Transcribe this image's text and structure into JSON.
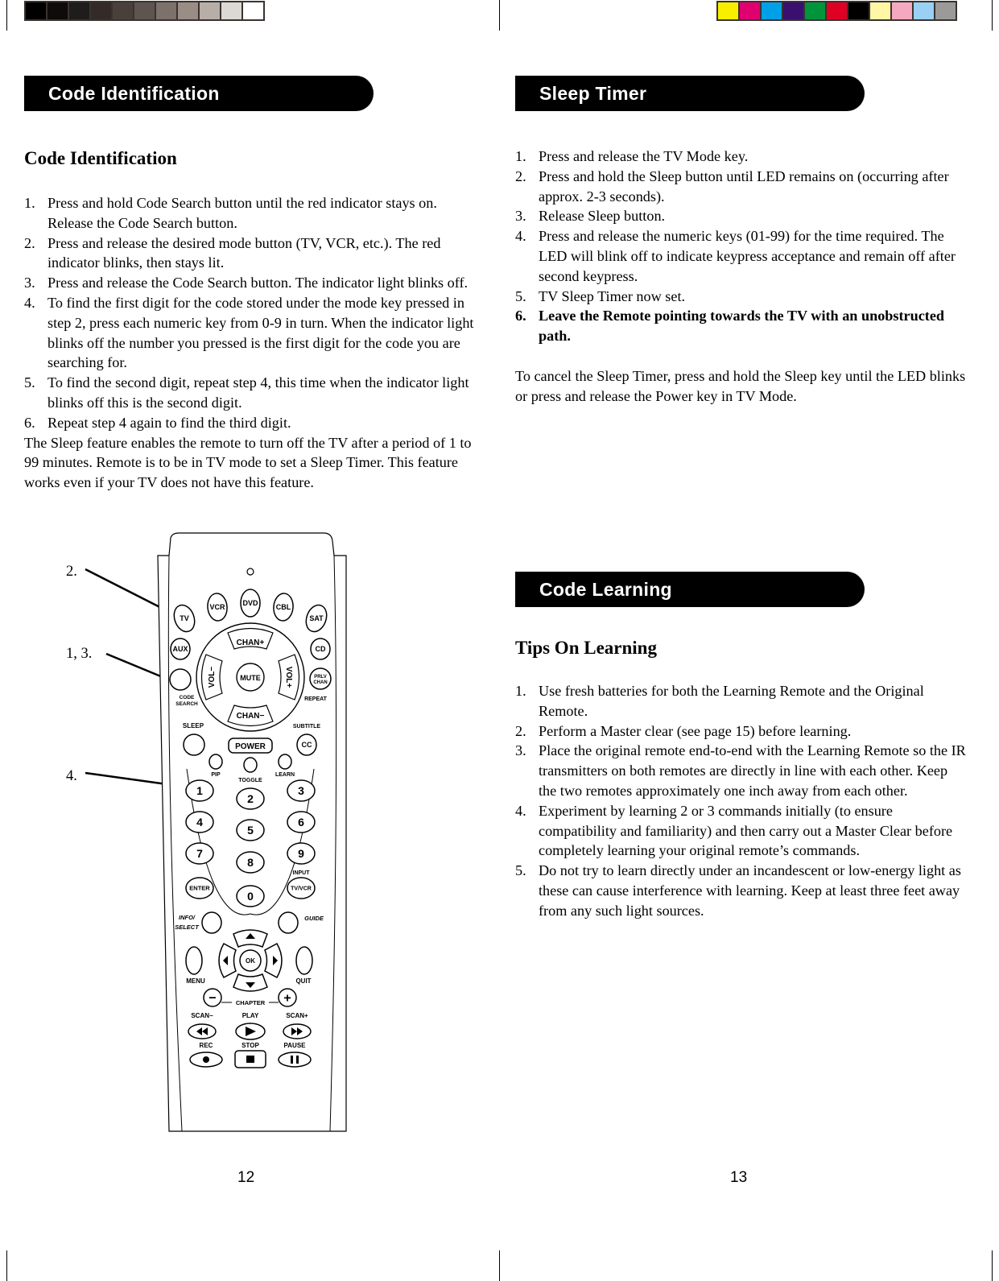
{
  "color_bars": {
    "grayscale": [
      "#000000",
      "#0f0b0b",
      "#1f1d1b",
      "#342a27",
      "#4a403b",
      "#5e5550",
      "#7d716c",
      "#9a8d86",
      "#b8aea8",
      "#dcd8d3",
      "#ffffff"
    ],
    "process": [
      "#f8ee00",
      "#e0006f",
      "#00a0e6",
      "#39106f",
      "#00953a",
      "#df0024",
      "#000000",
      "#fff7a6",
      "#f4a9c1",
      "#99d0f3",
      "#9a9a9a"
    ]
  },
  "left_page": {
    "banner": "Code Identification",
    "heading": "Code Identification",
    "steps": [
      {
        "num": "1.",
        "text": "Press and hold Code Search button until the red indicator stays on. Release the Code Search button."
      },
      {
        "num": "2.",
        "text": "Press and release the desired mode button (TV, VCR, etc.). The red indicator blinks, then stays lit."
      },
      {
        "num": "3.",
        "text": "Press and release the Code Search button. The indicator light blinks off."
      },
      {
        "num": "4.",
        "text": "To find the first digit for the code stored under the mode key pressed in step 2, press each numeric key from 0-9 in turn. When the indicator light blinks off the number you pressed is the first digit for the code you are searching for."
      },
      {
        "num": "5.",
        "text": "To find the second digit, repeat step 4, this time when the indicator light blinks off this is the second digit."
      },
      {
        "num": "6.",
        "text": "Repeat step 4 again to find the third digit."
      }
    ],
    "sleep_paragraph": "The Sleep feature enables the remote to turn off the TV after a period of 1 to 99 minutes. Remote is to be in TV mode to set a Sleep Timer. This feature works even if your TV does not have this feature.",
    "callouts": [
      "2.",
      "1, 3.",
      "4."
    ],
    "page_number": "12"
  },
  "remote": {
    "mode_keys": [
      "TV",
      "VCR",
      "DVD",
      "CBL",
      "SAT"
    ],
    "aux": "AUX",
    "cd": "CD",
    "code_search_label": [
      "CODE",
      "SEARCH"
    ],
    "prev_chan": [
      "PRLV",
      "CHAN"
    ],
    "repeat": "REPEAT",
    "chan_up": "CHAN+",
    "chan_down": "CHAN−",
    "vol_down": "VOL−",
    "vol_up": "VOL+",
    "mute": "MUTE",
    "sleep": "SLEEP",
    "subtitle": "SUBTITLE",
    "cc": "CC",
    "power": "POWER",
    "pip": "PIP",
    "toggle": "TOGGLE",
    "learn": "LEARN",
    "digits": [
      "1",
      "2",
      "3",
      "4",
      "5",
      "6",
      "7",
      "8",
      "9",
      "0"
    ],
    "enter": "ENTER",
    "input_label": "INPUT",
    "tv_vcr": "TV/VCR",
    "info_select": [
      "INFO/",
      "SELECT"
    ],
    "guide": "GUIDE",
    "ok": "OK",
    "menu": "MENU",
    "quit": "QUIT",
    "chapter": "CHAPTER",
    "scan_minus": "SCAN−",
    "play": "PLAY",
    "scan_plus": "SCAN+",
    "rec": "REC",
    "stop": "STOP",
    "pause": "PAUSE"
  },
  "right_page": {
    "sleep_banner": "Sleep Timer",
    "sleep_steps": [
      {
        "num": "1.",
        "text": "Press and release the TV Mode key.",
        "bold": false
      },
      {
        "num": "2.",
        "text": "Press and hold the Sleep button until LED remains on (occurring after approx. 2-3 seconds).",
        "bold": false
      },
      {
        "num": "3.",
        "text": "Release Sleep button.",
        "bold": false
      },
      {
        "num": "4.",
        "text": "Press and release the numeric keys (01-99) for the time required. The LED will blink off to indicate keypress acceptance and remain off after second keypress.",
        "bold": false
      },
      {
        "num": "5.",
        "text": "TV Sleep Timer now set.",
        "bold": false
      },
      {
        "num": "6.",
        "text": "Leave the Remote pointing towards the TV with an unobstructed path.",
        "bold": true
      }
    ],
    "cancel_paragraph": "To cancel the Sleep Timer, press and hold the Sleep key until the LED blinks or press and release the Power key in TV Mode.",
    "learning_banner": "Code Learning",
    "learning_heading": "Tips On Learning",
    "learning_steps": [
      {
        "num": "1.",
        "text": "Use fresh batteries for both the Learning Remote and the Original Remote."
      },
      {
        "num": "2.",
        "text": "Perform a Master clear (see page 15) before learning."
      },
      {
        "num": "3.",
        "text": "Place the original remote end-to-end with the  Learning Remote so the IR transmitters on both remotes are directly in line with each other. Keep the two remotes approximately one inch away from each other."
      },
      {
        "num": "4.",
        "text": "Experiment by learning 2 or 3 commands initially (to ensure compatibility and familiarity) and then carry out a Master Clear before completely learning your original remote’s commands."
      },
      {
        "num": "5.",
        "text": "Do not try to learn directly under an incandescent or low-energy light as these can cause interference with learning. Keep at least three feet away from any such light sources."
      }
    ],
    "page_number": "13"
  }
}
